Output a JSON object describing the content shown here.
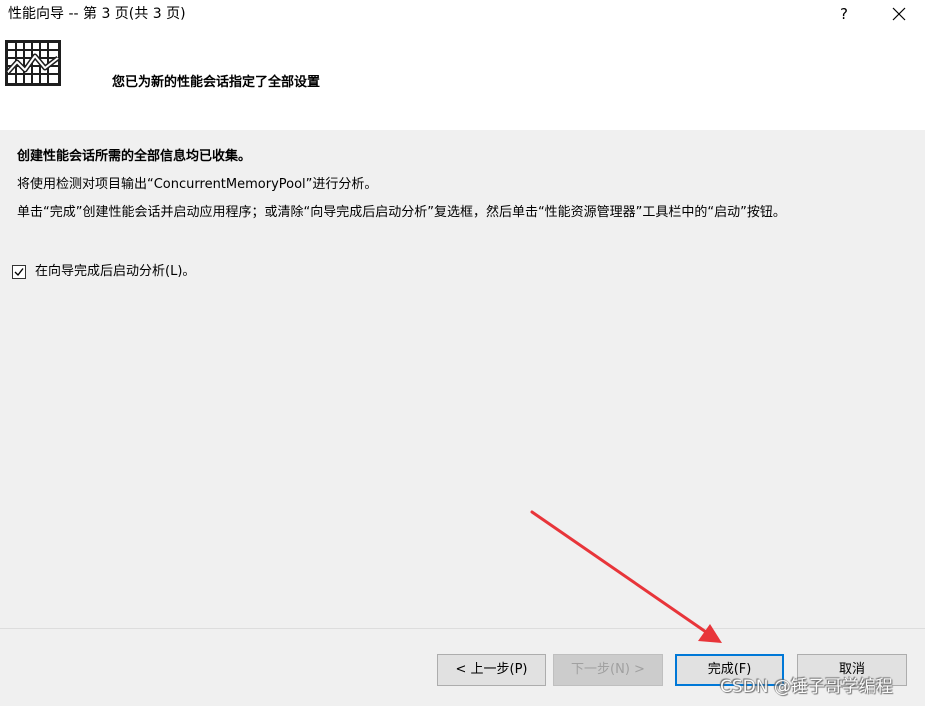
{
  "window": {
    "title": "性能向导 -- 第 3 页(共 3 页)",
    "help_label": "?",
    "close_icon": "close-icon"
  },
  "header": {
    "icon": "performance-chart-icon",
    "heading": "您已为新的性能会话指定了全部设置"
  },
  "content": {
    "line1": "创建性能会话所需的全部信息均已收集。",
    "line2": "将使用检测对项目输出“ConcurrentMemoryPool”进行分析。",
    "line3": "单击“完成”创建性能会话并启动应用程序；或清除“向导完成后启动分析”复选框，然后单击“性能资源管理器”工具栏中的“启动”按钮。",
    "checkbox": {
      "label": "在向导完成后启动分析(L)。",
      "checked": true
    }
  },
  "footer": {
    "prev_label": "< 上一步(P)",
    "next_label": "下一步(N) >",
    "finish_label": "完成(F)",
    "cancel_label": "取消"
  },
  "annotation": {
    "arrow_color": "#e8353a"
  },
  "watermark": "CSDN @锤子哥学编程",
  "colors": {
    "accent": "#0078d7",
    "panel": "#f0f0f0",
    "button": "#e1e1e1"
  }
}
